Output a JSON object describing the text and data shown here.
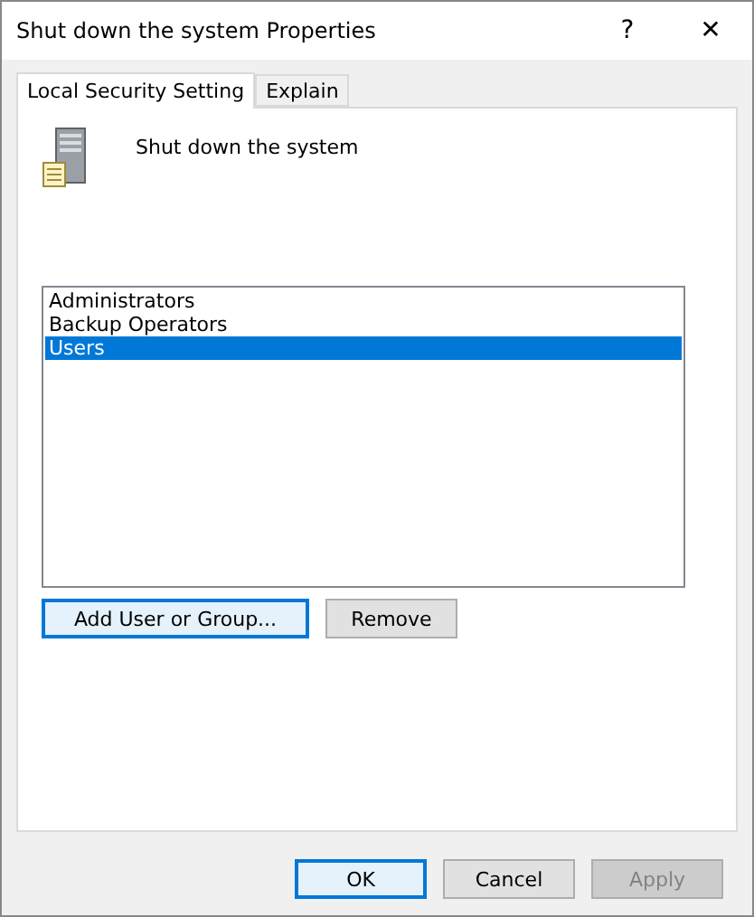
{
  "window": {
    "title": "Shut down the system Properties",
    "help": "?",
    "close": "✕"
  },
  "tabs": [
    {
      "label": "Local Security Setting",
      "selected": true
    },
    {
      "label": "Explain",
      "selected": false
    }
  ],
  "policy": {
    "name": "Shut down the system"
  },
  "members": [
    {
      "label": "Administrators",
      "selected": false
    },
    {
      "label": "Backup Operators",
      "selected": false
    },
    {
      "label": "Users",
      "selected": true
    }
  ],
  "member_buttons": [
    {
      "label": "Add User or Group...",
      "focused": true,
      "disabled": false
    },
    {
      "label": "Remove",
      "focused": false,
      "disabled": false
    }
  ],
  "dialog_buttons": [
    {
      "label": "OK",
      "focused": true,
      "disabled": false
    },
    {
      "label": "Cancel",
      "focused": false,
      "disabled": false
    },
    {
      "label": "Apply",
      "focused": false,
      "disabled": true
    }
  ]
}
